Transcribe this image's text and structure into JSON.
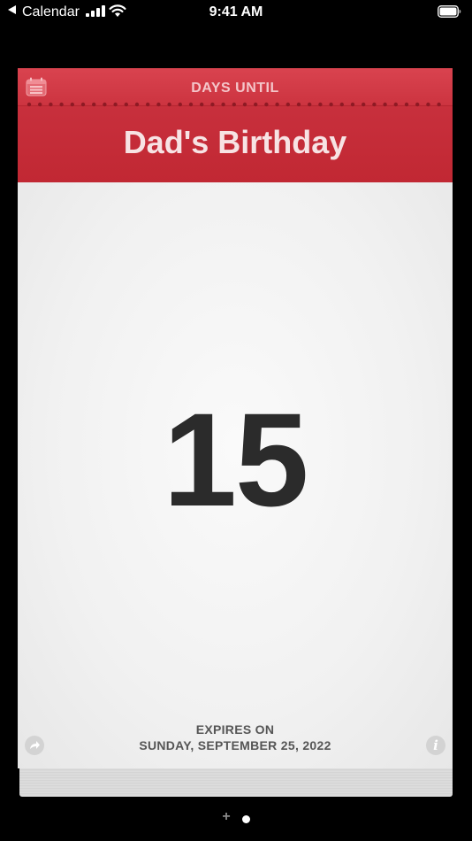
{
  "status_bar": {
    "back_label": "Calendar",
    "time": "9:41 AM"
  },
  "header": {
    "subtitle": "DAYS UNTIL",
    "title": "Dad's Birthday",
    "color": "#c8303d"
  },
  "page": {
    "count": "15",
    "expires_label": "EXPIRES ON",
    "expires_date": "SUNDAY, SEPTEMBER 25, 2022",
    "info_glyph": "i"
  },
  "pager": {
    "add_glyph": "+",
    "pages": 1,
    "current": 1
  },
  "icons": [
    "back-arrow-icon",
    "cellular-signal-icon",
    "wifi-icon",
    "battery-icon",
    "calendar-icon",
    "share-icon",
    "info-icon",
    "add-icon"
  ]
}
